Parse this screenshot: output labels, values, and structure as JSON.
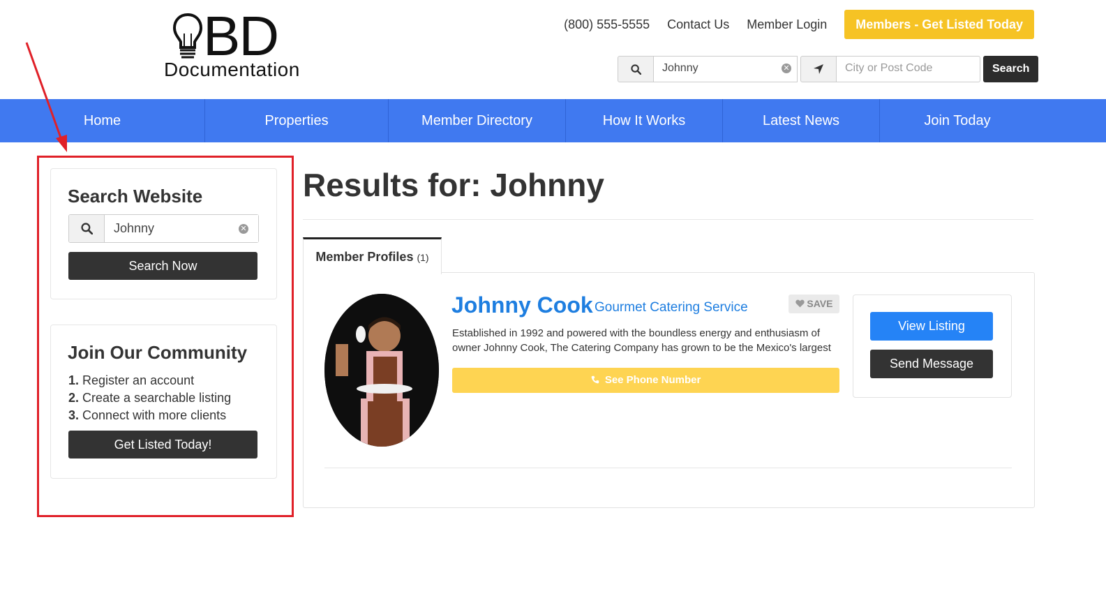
{
  "header": {
    "logo": {
      "big_text": "BD",
      "sub_text": "Documentation"
    },
    "phone": "(800) 555-5555",
    "contact_label": "Contact Us",
    "login_label": "Member Login",
    "cta_label": "Members - Get Listed Today",
    "search": {
      "keyword_value": "Johnny",
      "location_placeholder": "City or Post Code",
      "button_label": "Search"
    }
  },
  "nav": {
    "items": [
      {
        "label": "Home"
      },
      {
        "label": "Properties"
      },
      {
        "label": "Member Directory"
      },
      {
        "label": "How It Works"
      },
      {
        "label": "Latest News"
      },
      {
        "label": "Join Today"
      }
    ]
  },
  "sidebar": {
    "search_widget": {
      "title": "Search Website",
      "input_value": "Johnny",
      "button_label": "Search Now"
    },
    "join_widget": {
      "title": "Join Our Community",
      "steps": [
        {
          "num": "1.",
          "text": "Register an account"
        },
        {
          "num": "2.",
          "text": "Create a searchable listing"
        },
        {
          "num": "3.",
          "text": "Connect with more clients"
        }
      ],
      "button_label": "Get Listed Today!"
    }
  },
  "main": {
    "results_title": "Results for: Johnny",
    "tab": {
      "label": "Member Profiles",
      "count": "(1)"
    },
    "member": {
      "name": "Johnny Cook",
      "category": "Gourmet Catering Service",
      "save_label": "SAVE",
      "description": "Established in 1992 and powered with the boundless energy and enthusiasm of owner Johnny Cook, The Catering Company has grown to be the Mexico's largest",
      "phone_button_label": "See Phone Number",
      "view_button_label": "View Listing",
      "message_button_label": "Send Message"
    }
  },
  "colors": {
    "nav_bg": "#4079f0",
    "cta_yellow": "#f6c324",
    "phone_yellow": "#fed452",
    "link_blue": "#1e7ee0",
    "primary_blue": "#2583f6",
    "dark_button": "#333333",
    "annotation_red": "#e02028"
  },
  "icons": [
    "lightbulb-logo-icon",
    "search-icon",
    "clear-icon",
    "location-arrow-icon",
    "heart-icon",
    "phone-icon",
    "annotation-arrow"
  ]
}
